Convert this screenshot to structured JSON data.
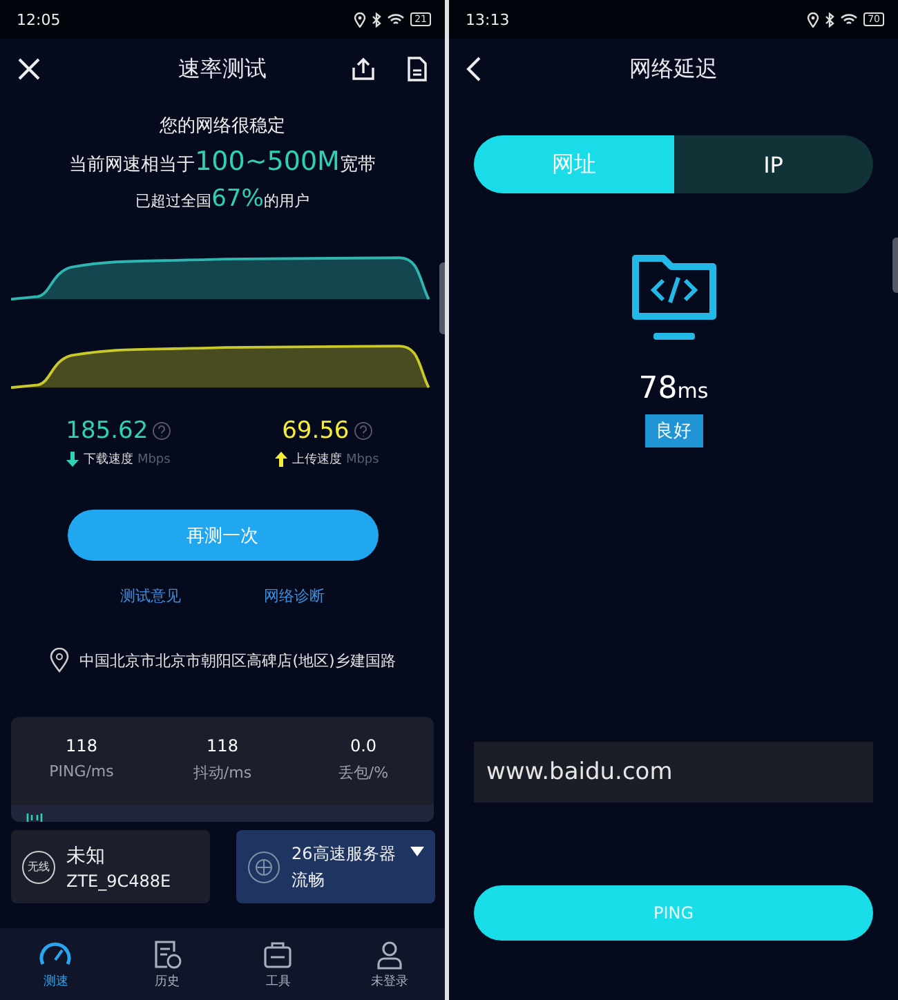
{
  "left_screen": {
    "status_bar": {
      "time": "12:05",
      "battery": "21"
    },
    "header": {
      "title": "速率测试"
    },
    "summary": {
      "line_1": "您的网络很稳定",
      "line_2": {
        "prefix": "当前网速相当于",
        "highlight": "100~500M",
        "suffix": "宽带"
      },
      "line_3": {
        "prefix": "已超过全国",
        "highlight": "67%",
        "suffix": "的用户"
      }
    },
    "speeds": [
      {
        "kind": "download",
        "value": "185.62",
        "label": "下载速度",
        "unit": "Mbps"
      },
      {
        "kind": "upload",
        "value": "69.56",
        "label": "上传速度",
        "unit": "Mbps"
      }
    ],
    "retest_button": "再测一次",
    "links": [
      "测试意见",
      "网络诊断"
    ],
    "location": "中国北京市北京市朝阳区高碑店(地区)乡建国路",
    "stats": [
      {
        "value": "118",
        "label": "PING/ms"
      },
      {
        "value": "118",
        "label": "抖动/ms"
      },
      {
        "value": "0.0",
        "label": "丢包/%"
      }
    ],
    "network_card": {
      "badge": "无线",
      "name": "未知",
      "ssid": "ZTE_9C488E"
    },
    "server_card": {
      "name": "26高速服务器",
      "status": "流畅"
    },
    "nav": [
      {
        "kind": "speed",
        "label": "测速",
        "selected": true
      },
      {
        "kind": "history",
        "label": "历史",
        "selected": false
      },
      {
        "kind": "tools",
        "label": "工具",
        "selected": false
      },
      {
        "kind": "user",
        "label": "未登录",
        "selected": false
      }
    ]
  },
  "right_screen": {
    "status_bar": {
      "time": "13:13",
      "battery": "70"
    },
    "header": {
      "title": "网络延迟"
    },
    "tabs": [
      {
        "label": "网址",
        "selected": true
      },
      {
        "label": "IP",
        "selected": false
      }
    ],
    "latency": {
      "value": "78",
      "unit": "ms",
      "rating": "良好"
    },
    "address_field": {
      "value": "www.baidu.com"
    },
    "ping_button": "PING"
  }
}
